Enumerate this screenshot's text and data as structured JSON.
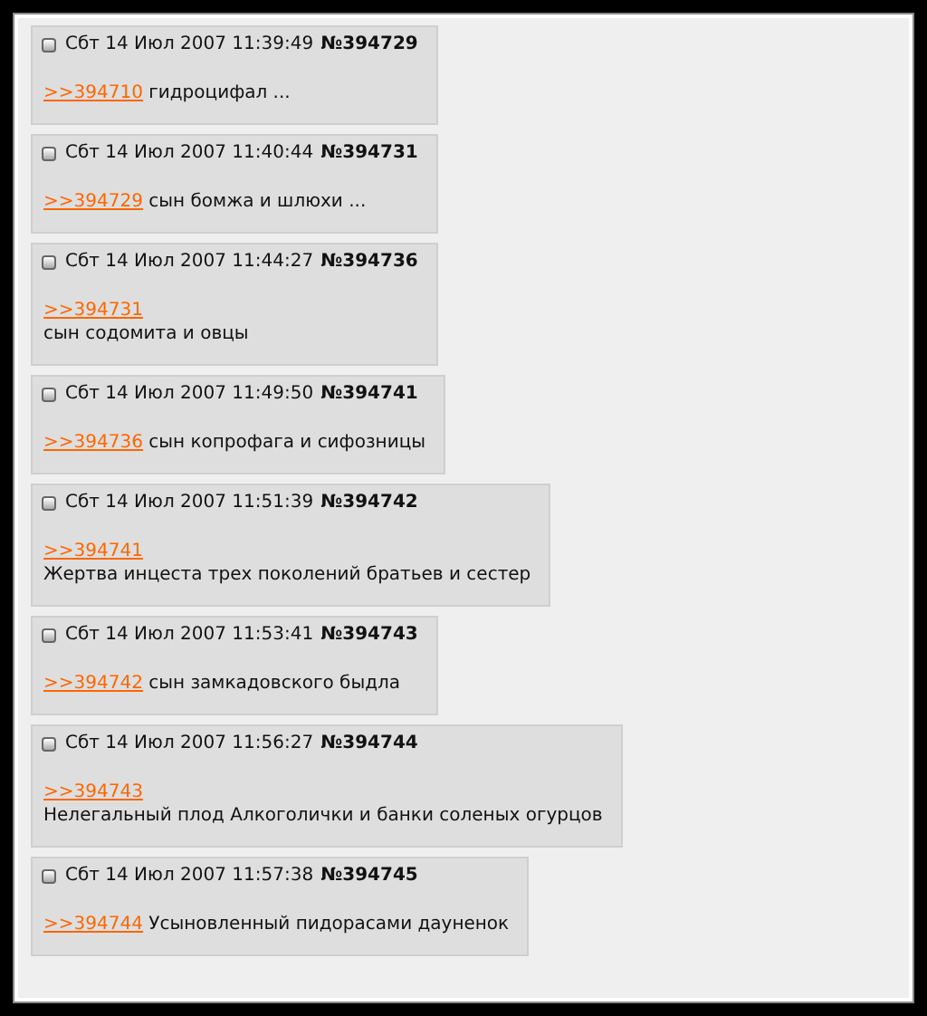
{
  "posts": [
    {
      "checked": false,
      "date": "Сбт 14 Июл 2007 11:39:49",
      "number": "№394729",
      "reply_link": ">>394710",
      "text": "гидроцифал ...",
      "kind": "inline"
    },
    {
      "checked": false,
      "date": "Сбт 14 Июл 2007 11:40:44",
      "number": "№394731",
      "reply_link": ">>394729",
      "text": "сын бомжа и шлюхи ...",
      "kind": "inline"
    },
    {
      "checked": false,
      "date": "Сбт 14 Июл 2007 11:44:27",
      "number": "№394736",
      "reply_link": ">>394731",
      "text": "сын содомита и овцы",
      "kind": "block"
    },
    {
      "checked": false,
      "date": "Сбт 14 Июл 2007 11:49:50",
      "number": "№394741",
      "reply_link": ">>394736",
      "text": "сын копрофага и сифозницы",
      "kind": "inline"
    },
    {
      "checked": false,
      "date": "Сбт 14 Июл 2007 11:51:39",
      "number": "№394742",
      "reply_link": ">>394741",
      "text": "Жертва инцеста трех поколений братьев и сестер",
      "kind": "block"
    },
    {
      "checked": false,
      "date": "Сбт 14 Июл 2007 11:53:41",
      "number": "№394743",
      "reply_link": ">>394742",
      "text": "сын замкадовского быдла",
      "kind": "inline"
    },
    {
      "checked": false,
      "date": "Сбт 14 Июл 2007 11:56:27",
      "number": "№394744",
      "reply_link": ">>394743",
      "text": "Нелегальный плод Алкоголички и банки соленых огурцов",
      "kind": "block"
    },
    {
      "checked": false,
      "date": "Сбт 14 Июл 2007 11:57:38",
      "number": "№394745",
      "reply_link": ">>394744",
      "text": "Усыновленный пидорасами дауненок",
      "kind": "inline"
    }
  ]
}
